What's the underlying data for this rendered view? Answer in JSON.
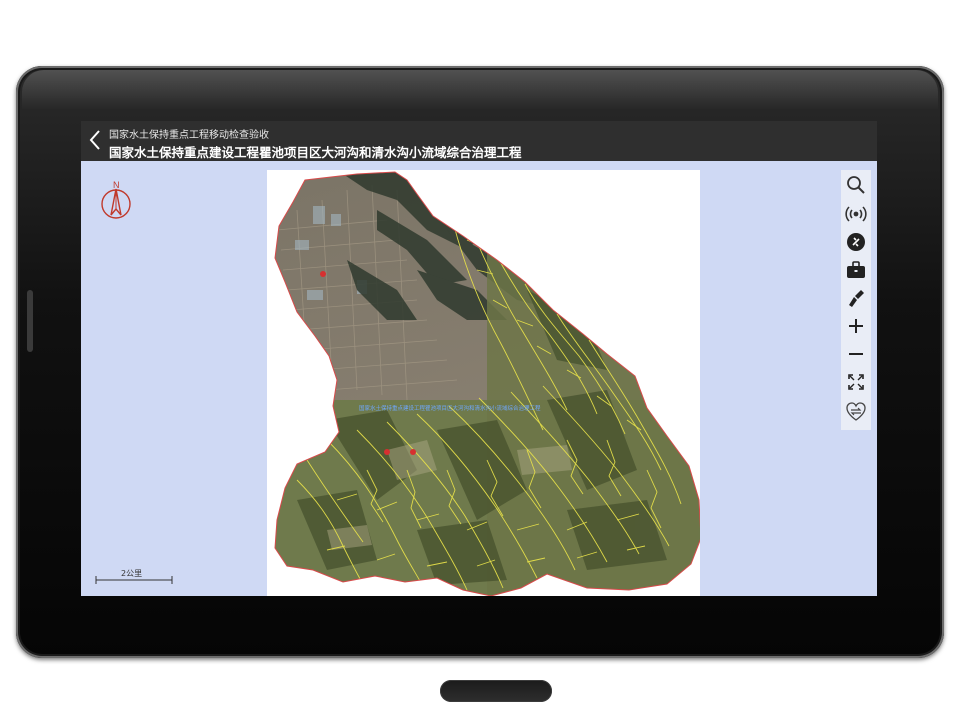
{
  "header": {
    "subtitle": "国家水土保持重点工程移动检查验收",
    "title": "国家水土保持重点建设工程瞿池项目区大河沟和清水沟小流域综合治理工程"
  },
  "map": {
    "north_label": "N",
    "scale_label": "2公里",
    "boundary_label": "国家水土保持重点建设工程瞿池项目区大河沟和清水沟小流域综合治理工程"
  },
  "toolbar": {
    "icons": [
      "search-icon",
      "signal-icon",
      "tools-icon",
      "briefcase-icon",
      "brush-icon",
      "zoom-in-icon",
      "zoom-out-icon",
      "fullscreen-icon",
      "swap-icon"
    ]
  },
  "colors": {
    "screen_background": "#cfd9f4",
    "header_background": "#2f2f2f",
    "boundary": "#d84a4a",
    "gully_lines": "#e6e04a"
  }
}
